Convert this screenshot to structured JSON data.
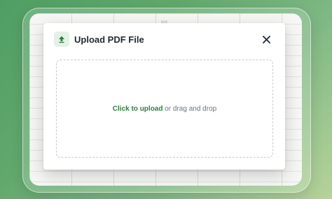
{
  "dialog": {
    "title": "Upload PDF File",
    "icon": "upload-icon",
    "close_icon": "close-icon"
  },
  "dropzone": {
    "action_label": "Click to upload",
    "rest_label": " or drag and drop"
  },
  "colors": {
    "accent": "#2f7d3e",
    "icon_background": "#e4f1e6"
  }
}
